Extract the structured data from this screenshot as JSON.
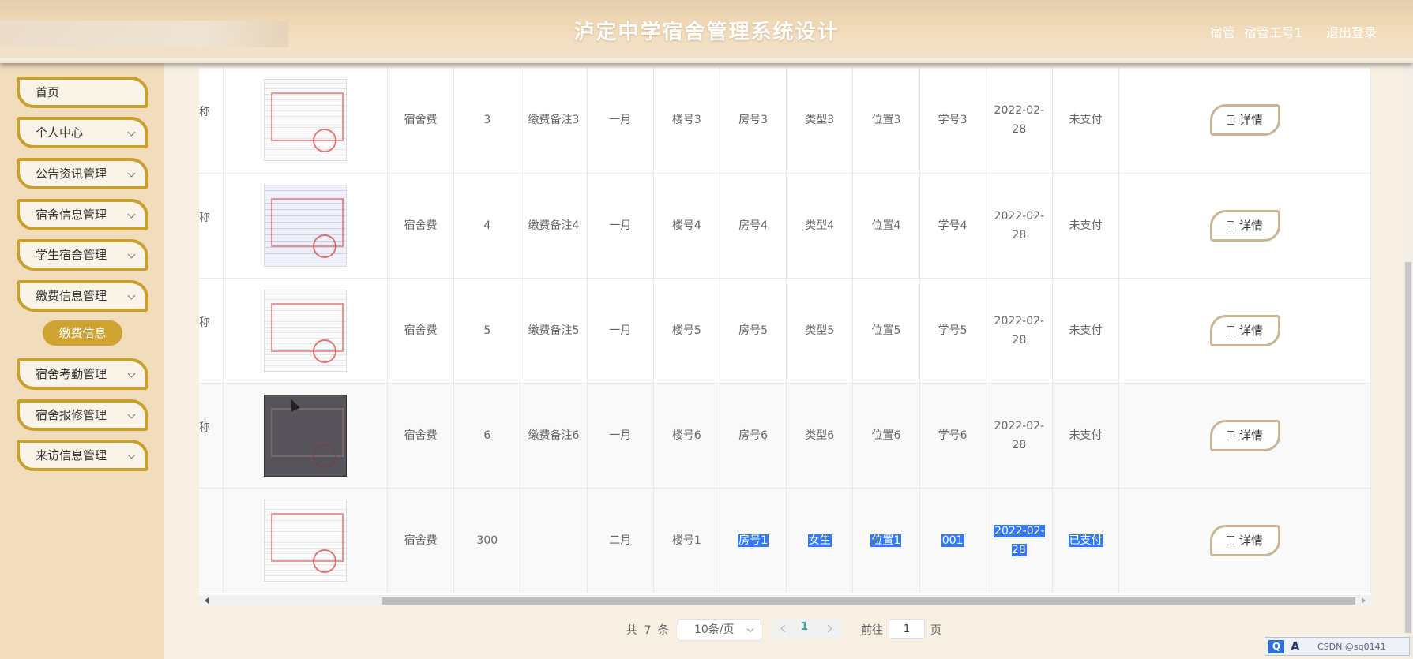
{
  "header": {
    "title": "泸定中学宿舍管理系统设计",
    "role": "宿管",
    "username": "宿管工号1",
    "logout_label": "退出登录"
  },
  "sidebar": {
    "items": [
      {
        "label": "首页",
        "expandable": false
      },
      {
        "label": "个人中心",
        "expandable": true
      },
      {
        "label": "公告资讯管理",
        "expandable": true
      },
      {
        "label": "宿舍信息管理",
        "expandable": true
      },
      {
        "label": "学生宿舍管理",
        "expandable": true
      },
      {
        "label": "缴费信息管理",
        "expandable": true
      },
      {
        "label": "宿舍考勤管理",
        "expandable": true
      },
      {
        "label": "宿舍报修管理",
        "expandable": true
      },
      {
        "label": "来访信息管理",
        "expandable": true
      }
    ],
    "active_sub_item": "缴费信息"
  },
  "table": {
    "rows": [
      {
        "name": "称",
        "fee_type": "宿舍费",
        "amount": "3",
        "remark": "缴费备注3",
        "month": "一月",
        "building": "楼号3",
        "room": "房号3",
        "room_type": "类型3",
        "position": "位置3",
        "student_id": "学号3",
        "date": "2022-02-28",
        "status": "未支付",
        "action": "详情"
      },
      {
        "name": "称",
        "fee_type": "宿舍费",
        "amount": "4",
        "remark": "缴费备注4",
        "month": "一月",
        "building": "楼号4",
        "room": "房号4",
        "room_type": "类型4",
        "position": "位置4",
        "student_id": "学号4",
        "date": "2022-02-28",
        "status": "未支付",
        "action": "详情"
      },
      {
        "name": "称",
        "fee_type": "宿舍费",
        "amount": "5",
        "remark": "缴费备注5",
        "month": "一月",
        "building": "楼号5",
        "room": "房号5",
        "room_type": "类型5",
        "position": "位置5",
        "student_id": "学号5",
        "date": "2022-02-28",
        "status": "未支付",
        "action": "详情"
      },
      {
        "name": "称",
        "fee_type": "宿舍费",
        "amount": "6",
        "remark": "缴费备注6",
        "month": "一月",
        "building": "楼号6",
        "room": "房号6",
        "room_type": "类型6",
        "position": "位置6",
        "student_id": "学号6",
        "date": "2022-02-28",
        "status": "未支付",
        "action": "详情"
      },
      {
        "name": "",
        "fee_type": "宿舍费",
        "amount": "300",
        "remark": "",
        "month": "二月",
        "building": "楼号1",
        "room": "房号1",
        "room_type": "女生",
        "position": "位置1",
        "student_id": "001",
        "date": "2022-02-28",
        "status": "已支付",
        "action": "详情"
      }
    ]
  },
  "pagination": {
    "total_prefix": "共",
    "total": "7",
    "total_suffix": "条",
    "page_size": "10条/页",
    "current_page": "1",
    "goto_label": "前往",
    "goto_value": "1",
    "page_unit": "页"
  },
  "tray": {
    "q": "Q",
    "a": "A",
    "text": "CSDN @sq0141"
  }
}
